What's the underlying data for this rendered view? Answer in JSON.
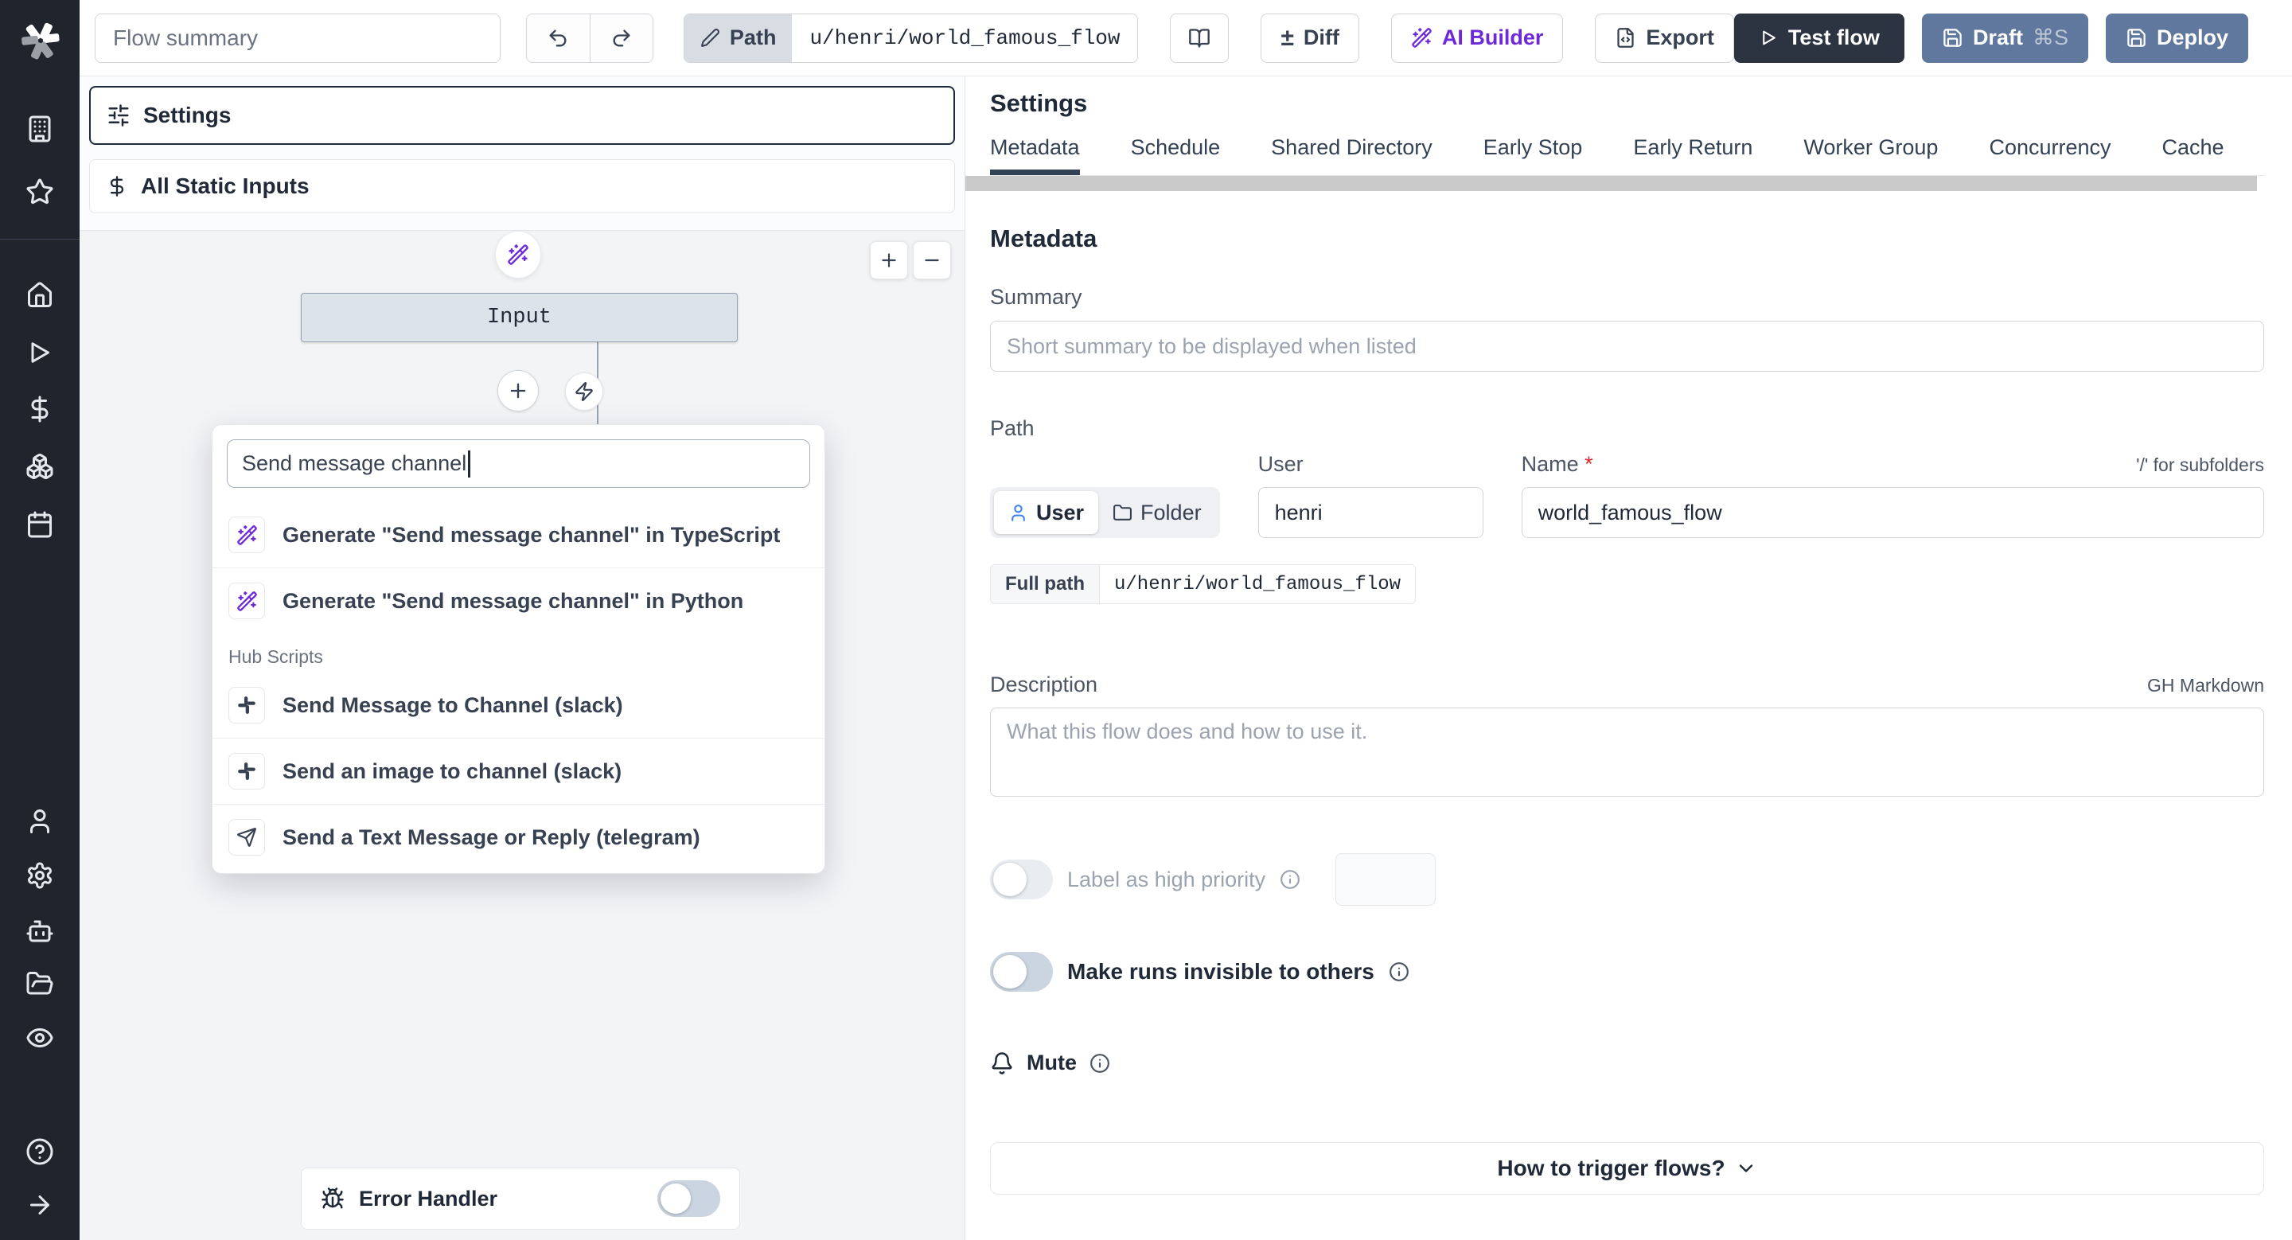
{
  "topbar": {
    "flow_summary_placeholder": "Flow summary",
    "path_label": "Path",
    "path_value": "u/henri/world_famous_flow",
    "diff_symbol": "±",
    "diff_label": "Diff",
    "ai_builder_label": "AI Builder",
    "export_label": "Export",
    "test_flow_label": "Test flow",
    "draft_label": "Draft",
    "draft_shortcut": "⌘S",
    "deploy_label": "Deploy"
  },
  "flow_panel": {
    "settings_label": "Settings",
    "all_static_inputs_label": "All Static Inputs",
    "input_node_label": "Input",
    "zoom_in": "+",
    "zoom_out": "−",
    "search_value": "Send message channel",
    "suggestions": [
      {
        "label": "Generate \"Send message channel\" in TypeScript",
        "icon": "wand-icon"
      },
      {
        "label": "Generate \"Send message channel\" in Python",
        "icon": "wand-icon"
      }
    ],
    "hub_scripts_label": "Hub Scripts",
    "hub_items": [
      {
        "label": "Send Message to Channel (slack)",
        "icon": "slack-icon"
      },
      {
        "label": "Send an image to channel (slack)",
        "icon": "slack-icon"
      },
      {
        "label": "Send a Text Message or Reply (telegram)",
        "icon": "telegram-send-icon"
      }
    ],
    "error_handler_label": "Error Handler"
  },
  "settings_panel": {
    "title": "Settings",
    "tabs": [
      "Metadata",
      "Schedule",
      "Shared Directory",
      "Early Stop",
      "Early Return",
      "Worker Group",
      "Concurrency",
      "Cache"
    ],
    "active_tab": "Metadata",
    "metadata": {
      "heading": "Metadata",
      "summary_label": "Summary",
      "summary_placeholder": "Short summary to be displayed when listed",
      "path_label": "Path",
      "owner_user_label": "User",
      "owner_folder_label": "Folder",
      "user_field_label": "User",
      "user_value": "henri",
      "name_label": "Name",
      "name_required_mark": "*",
      "name_value": "world_famous_flow",
      "subfolder_hint": "'/' for subfolders",
      "full_path_label": "Full path",
      "full_path_value": "u/henri/world_famous_flow",
      "description_label": "Description",
      "markdown_hint": "GH Markdown",
      "description_placeholder": "What this flow does and how to use it.",
      "high_priority_label": "Label as high priority",
      "invisible_runs_label": "Make runs invisible to others",
      "mute_label": "Mute",
      "trigger_label": "How to trigger flows?"
    }
  },
  "colors": {
    "sidebar_bg": "#20242d",
    "canvas_bg": "#f3f4f6",
    "primary_dark_button": "#2b3440",
    "secondary_blue_button": "#60789d",
    "accent_purple": "#6d28d9",
    "active_tab_underline": "#334155",
    "input_node_bg": "#dde3eb"
  }
}
